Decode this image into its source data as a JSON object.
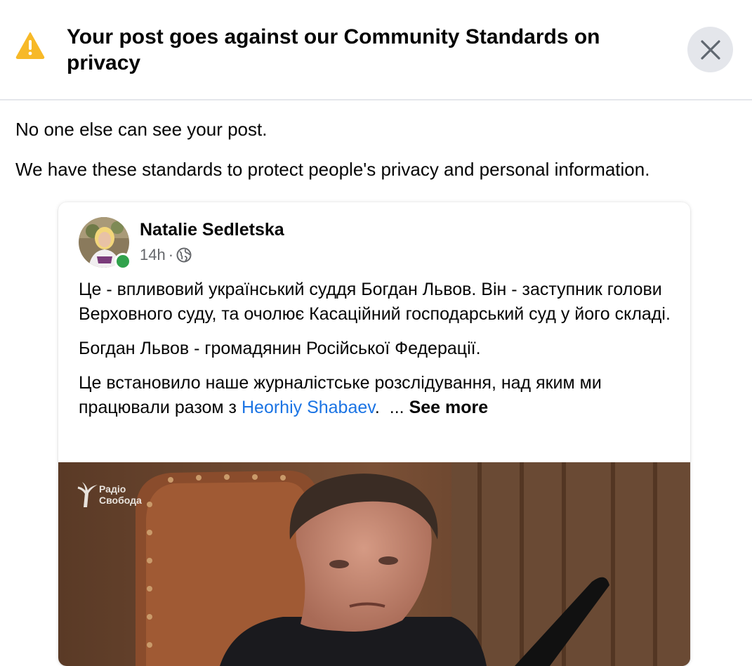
{
  "dialog": {
    "title": "Your post goes against our Community Standards on privacy",
    "message_1": "No one else can see your post.",
    "message_2": "We have these standards to protect people's privacy and personal information."
  },
  "post": {
    "author": "Natalie Sedletska",
    "time": "14h",
    "meta_separator": "·",
    "audience_icon": "globe-icon",
    "paragraph_1": "Це - впливовий український суддя Богдан Львов. Він - заступник голови Верховного суду, та очолює Касаційний господарський суд у його складі.",
    "paragraph_2": "Богдан Львов - громадянин Російської Федерації.",
    "paragraph_3_prefix": "Це встановило наше журналістське розслідування, над яким ми працювали разом з",
    "mention": "Heorhiy Shabaev",
    "paragraph_3_suffix": ".",
    "ellipsis": "...",
    "see_more": "See more",
    "image_logo_line_1": "Радіо",
    "image_logo_line_2": "Свобода"
  },
  "colors": {
    "warning": "#f7b928",
    "link": "#1b74e4",
    "online": "#31a24c",
    "secondary_text": "#65676b"
  }
}
